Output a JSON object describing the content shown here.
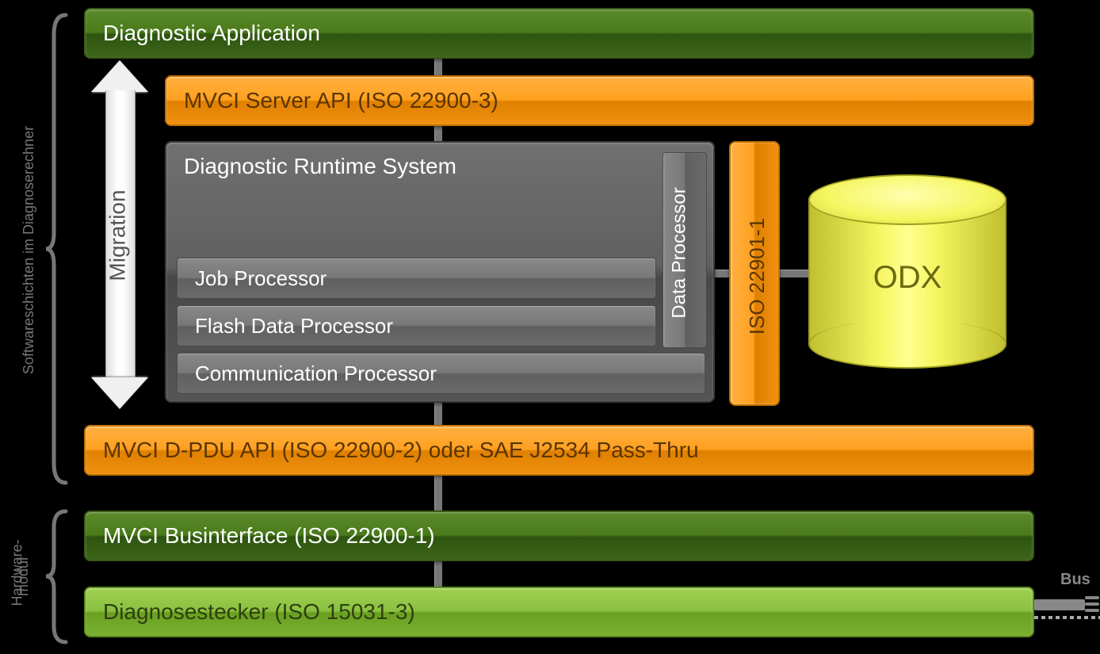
{
  "layers": {
    "app": "Diagnostic Application",
    "mvci_server": "MVCI Server API (ISO 22900-3)",
    "runtime": "Diagnostic Runtime System",
    "data_proc": "Data Processor",
    "job_proc": "Job Processor",
    "flash_proc": "Flash Data Processor",
    "comm_proc": "Communication Processor",
    "iso22901": "ISO 22901-1",
    "odx": "ODX",
    "mvci_dpdu": "MVCI D-PDU API (ISO 22900-2) oder SAE J2534 Pass-Thru",
    "businterface": "MVCI Businterface (ISO 22900-1)",
    "stecker": "Diagnosestecker (ISO 15031-3)"
  },
  "labels": {
    "migration": "Migration",
    "bus": "Bus",
    "sw_group": "Softwareschichten im Diagnoserechner",
    "hw_group_1": "Hardware-",
    "hw_group_2": "modul"
  }
}
